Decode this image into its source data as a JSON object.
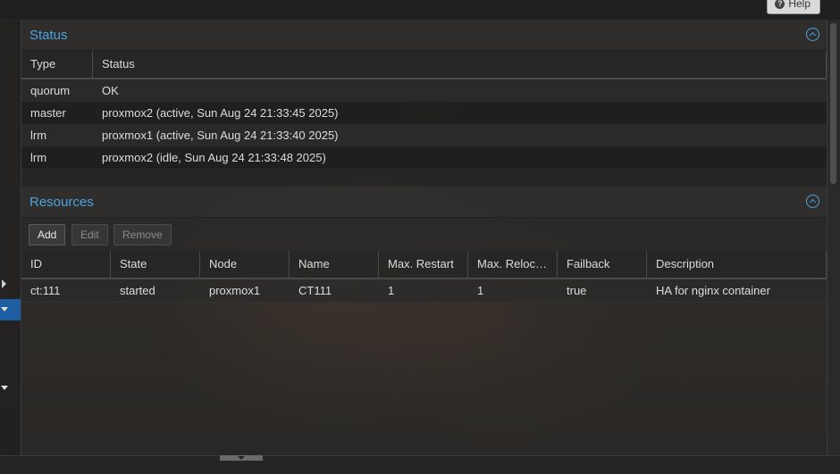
{
  "toolbar_top": {
    "help_label": "Help"
  },
  "status_panel": {
    "title": "Status",
    "columns": [
      "Type",
      "Status"
    ],
    "rows": [
      {
        "type": "quorum",
        "status": "OK"
      },
      {
        "type": "master",
        "status": "proxmox2 (active, Sun Aug 24 21:33:45 2025)"
      },
      {
        "type": "lrm",
        "status": "proxmox1 (active, Sun Aug 24 21:33:40 2025)"
      },
      {
        "type": "lrm",
        "status": "proxmox2 (idle, Sun Aug 24 21:33:48 2025)"
      }
    ]
  },
  "resources_panel": {
    "title": "Resources",
    "buttons": {
      "add": "Add",
      "edit": "Edit",
      "remove": "Remove"
    },
    "columns": [
      "ID",
      "State",
      "Node",
      "Name",
      "Max. Restart",
      "Max. Reloc…",
      "Failback",
      "Description"
    ],
    "rows": [
      {
        "id": "ct:111",
        "state": "started",
        "node": "proxmox1",
        "name": "CT111",
        "max_restart": "1",
        "max_relocate": "1",
        "failback": "true",
        "description": "HA for nginx container"
      }
    ]
  },
  "colors": {
    "accent": "#4aa3df",
    "selected_nav": "#1e5fa3"
  }
}
